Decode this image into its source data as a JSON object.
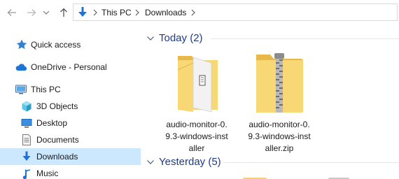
{
  "address": {
    "path": [
      "This PC",
      "Downloads"
    ]
  },
  "sidebar": {
    "items": [
      {
        "label": "Quick access",
        "icon": "star-icon"
      },
      {
        "label": "OneDrive - Personal",
        "icon": "cloud-icon"
      },
      {
        "label": "This PC",
        "icon": "computer-icon"
      },
      {
        "label": "3D Objects",
        "icon": "cube-icon"
      },
      {
        "label": "Desktop",
        "icon": "desktop-icon"
      },
      {
        "label": "Documents",
        "icon": "document-icon"
      },
      {
        "label": "Downloads",
        "icon": "download-icon",
        "selected": true
      },
      {
        "label": "Music",
        "icon": "music-icon"
      }
    ]
  },
  "groups": [
    {
      "title": "Today (2)"
    },
    {
      "title": "Yesterday (5)"
    }
  ],
  "files": [
    {
      "name": "audio-monitor-0.9.3-windows-installer",
      "lines": [
        "audio-monitor-0.",
        "9.3-windows-inst",
        "aller"
      ],
      "icon": "folder-installer-icon"
    },
    {
      "name": "audio-monitor-0.9.3-windows-installer.zip",
      "lines": [
        "audio-monitor-0.",
        "9.3-windows-inst",
        "aller.zip"
      ],
      "icon": "zip-folder-icon"
    }
  ],
  "colors": {
    "selection": "#cce8ff",
    "group_title": "#1e3a8a",
    "folder": "#f8d775",
    "accent_blue": "#1e73d8"
  }
}
